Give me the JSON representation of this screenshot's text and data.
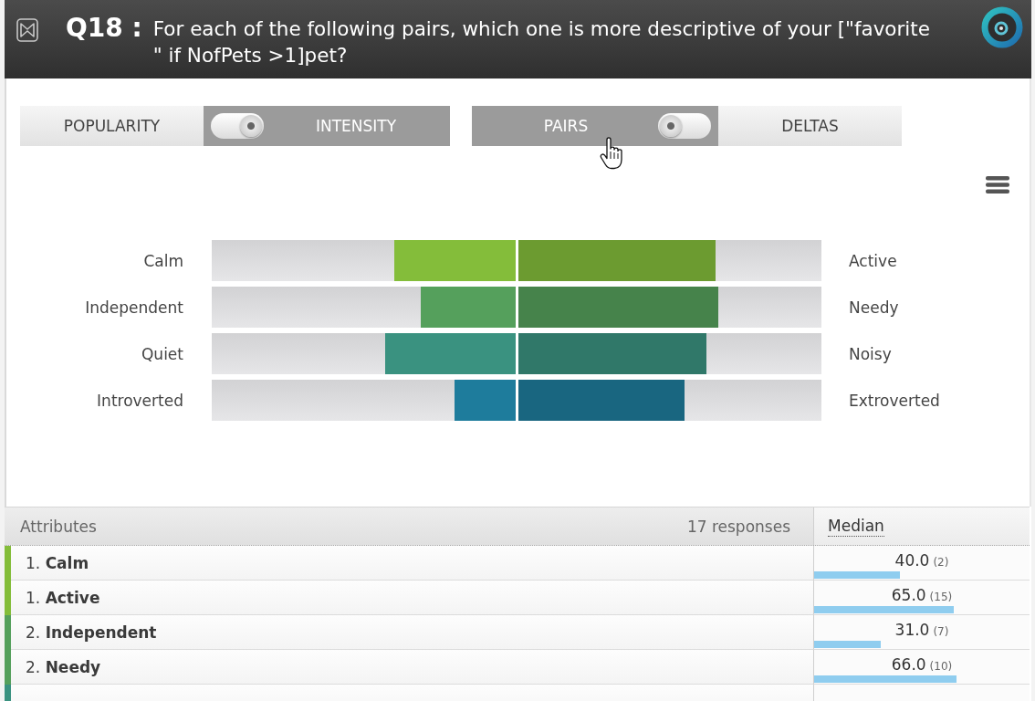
{
  "header": {
    "question_number": "Q18 :",
    "question": "For each of the following pairs, which one is more descriptive of your [\"favorite \" if NofPets >1]pet?"
  },
  "toggles": [
    {
      "options": [
        {
          "label": "POPULARITY",
          "selected": false
        },
        {
          "label": "INTENSITY",
          "selected": true
        }
      ]
    },
    {
      "options": [
        {
          "label": "PAIRS",
          "selected": true
        },
        {
          "label": "DELTAS",
          "selected": false
        }
      ]
    }
  ],
  "pairs": [
    {
      "color": "#84bd3a",
      "left": {
        "label": "Calm",
        "level": 0.4
      },
      "right": {
        "label": "Active",
        "level": 0.65
      }
    },
    {
      "color": "#55a05c",
      "left": {
        "label": "Independent",
        "level": 0.31
      },
      "right": {
        "label": "Needy",
        "level": 0.66
      }
    },
    {
      "color": "#3a9280",
      "left": {
        "label": "Quiet",
        "level": 0.43
      },
      "right": {
        "label": "Noisy",
        "level": 0.62
      }
    },
    {
      "color": "#1e7c9c",
      "left": {
        "label": "Introverted",
        "level": 0.2
      },
      "right": {
        "label": "Extroverted",
        "level": 0.55
      }
    }
  ],
  "table": {
    "attributes_heading": "Attributes",
    "responses": "17 responses",
    "median_heading": "Median",
    "rows": [
      {
        "attribute": "1. **Calm**",
        "color": "#84bd3a",
        "median": "40.0",
        "count": "(2)",
        "level": 0.4
      },
      {
        "attribute": "1. **Active**",
        "color": "#84bd3a",
        "median": "65.0",
        "count": "(15)",
        "level": 0.65
      },
      {
        "attribute": "2. **Independent**",
        "color": "#55a05c",
        "median": "31.0",
        "count": "(7)",
        "level": 0.31
      },
      {
        "attribute": "2. **Needy**",
        "color": "#55a05c",
        "median": "66.0",
        "count": "(10)",
        "level": 0.66
      },
      {
        "color": "#3a9280"
      }
    ]
  }
}
